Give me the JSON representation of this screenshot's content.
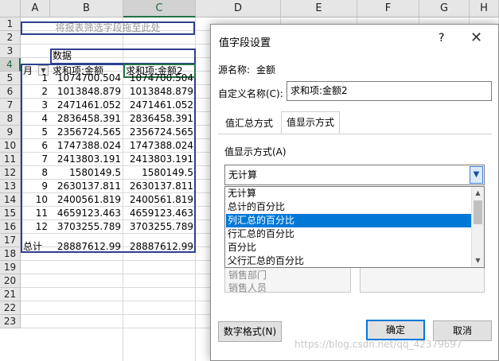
{
  "sheet": {
    "columns": [
      "A",
      "B",
      "C",
      "D",
      "E",
      "F",
      "G",
      "H"
    ],
    "rows": [
      "1",
      "2",
      "3",
      "4",
      "5",
      "6",
      "7",
      "8",
      "9",
      "10",
      "11",
      "12",
      "13",
      "14",
      "15",
      "16",
      "17",
      "18",
      "19",
      "20",
      "21",
      "22",
      "23"
    ],
    "filter_placeholder": "将报表筛选字段拖至此处",
    "pivot_data_label": "数据",
    "row_header": "月",
    "col_b_header": "求和项:金额",
    "col_c_header": "求和项:金额2",
    "months": [
      "1",
      "2",
      "3",
      "4",
      "5",
      "6",
      "7",
      "8",
      "9",
      "10",
      "11",
      "12"
    ],
    "values_b": [
      "1074700.504",
      "1013848.879",
      "2471461.052",
      "2836458.391",
      "2356724.565",
      "1747388.024",
      "2413803.191",
      "1580149.5",
      "2630137.811",
      "2400561.819",
      "4659123.463",
      "3703255.789"
    ],
    "values_c": [
      "1074700.504",
      "1013848.879",
      "2471461.052",
      "2836458.391",
      "2356724.565",
      "1747388.024",
      "2413803.191",
      "1580149.5",
      "2630137.811",
      "2400561.819",
      "4659123.463",
      "3703255.789"
    ],
    "total_label": "总计",
    "total_b": "28887612.99",
    "total_c": "28887612.99"
  },
  "dialog": {
    "title": "值字段设置",
    "help": "?",
    "close": "✕",
    "source_label": "源名称:",
    "source_value": "金额",
    "custom_label": "自定义名称(C):",
    "custom_value": "求和项:金额2",
    "tabs": [
      "值汇总方式",
      "值显示方式"
    ],
    "show_as_label": "值显示方式(A)",
    "combo_value": "无计算",
    "options": [
      "无计算",
      "总计的百分比",
      "列汇总的百分比",
      "行汇总的百分比",
      "百分比",
      "父行汇总的百分比"
    ],
    "selected_option": "列汇总的百分比",
    "base_field_items": [
      "销售部门",
      "销售人员"
    ],
    "number_format_button": "数字格式(N)",
    "ok_button": "确定",
    "cancel_button": "取消"
  },
  "watermark": "https://blog.csdn.net/qq_42379697"
}
